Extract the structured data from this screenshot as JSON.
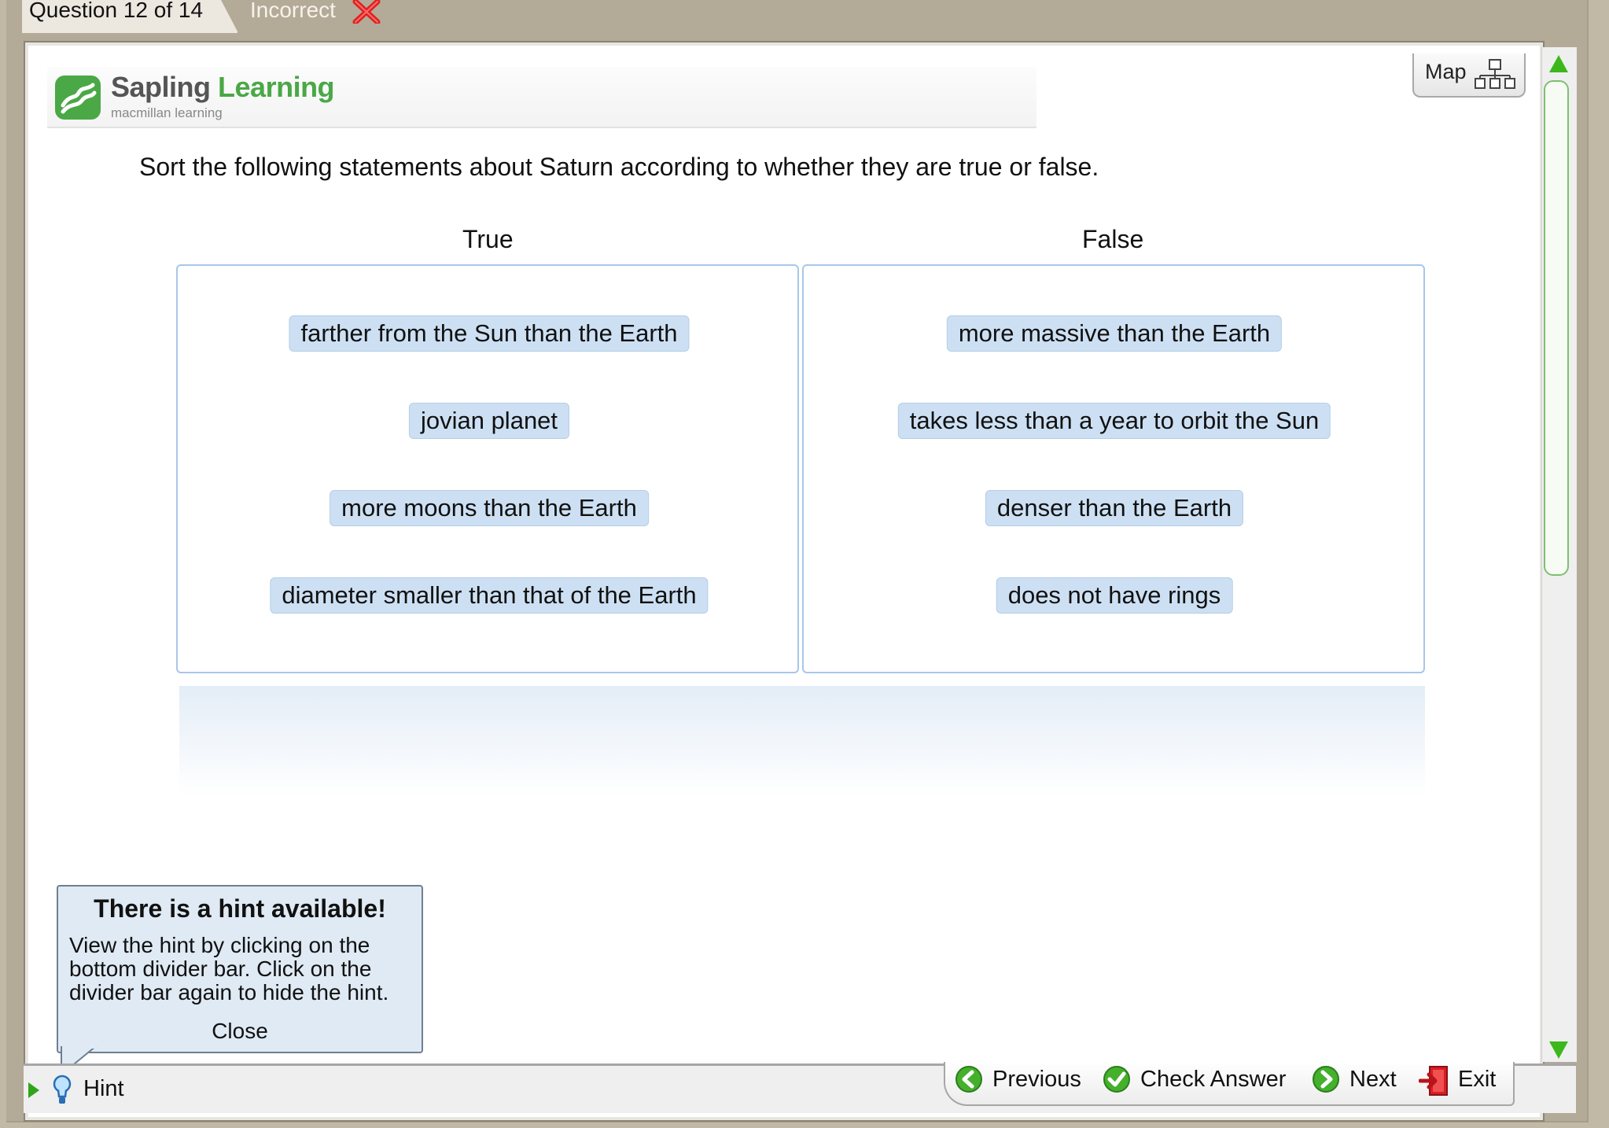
{
  "header": {
    "question_tab": "Question 12 of 14",
    "status": "Incorrect"
  },
  "logo": {
    "name_part1": "Sapling",
    "name_part2": "Learning",
    "subtitle": "macmillan learning"
  },
  "map_button": {
    "label": "Map"
  },
  "question_text": "Sort the following statements about Saturn according to whether they are true or false.",
  "bins": [
    {
      "heading": "True",
      "items": [
        "farther from the Sun than the Earth",
        "jovian planet",
        "more moons than the Earth",
        "diameter smaller than that of the Earth"
      ]
    },
    {
      "heading": "False",
      "items": [
        "more massive than the Earth",
        "takes less than a year to orbit the Sun",
        "denser than the Earth",
        "does not have rings"
      ]
    }
  ],
  "hint_popup": {
    "title": "There is a hint available!",
    "body": "View the hint by clicking on the bottom divider bar. Click on the divider bar again to hide the hint.",
    "close_label": "Close"
  },
  "bottom_bar": {
    "hint_label": "Hint",
    "previous_label": "Previous",
    "check_label": "Check Answer",
    "next_label": "Next",
    "exit_label": "Exit"
  },
  "icons": {
    "status": "x-icon",
    "logo": "sapling-logo-icon",
    "map": "sitemap-icon",
    "previous": "arrow-left-circle-icon",
    "check": "checkmark-circle-icon",
    "next": "arrow-right-circle-icon",
    "exit": "exit-door-icon",
    "hint": "lightbulb-icon"
  },
  "colors": {
    "chip_bg": "#cde0f3",
    "bin_border": "#a8c7e8",
    "brand_green": "#4aa846",
    "incorrect_red": "#e02020"
  }
}
